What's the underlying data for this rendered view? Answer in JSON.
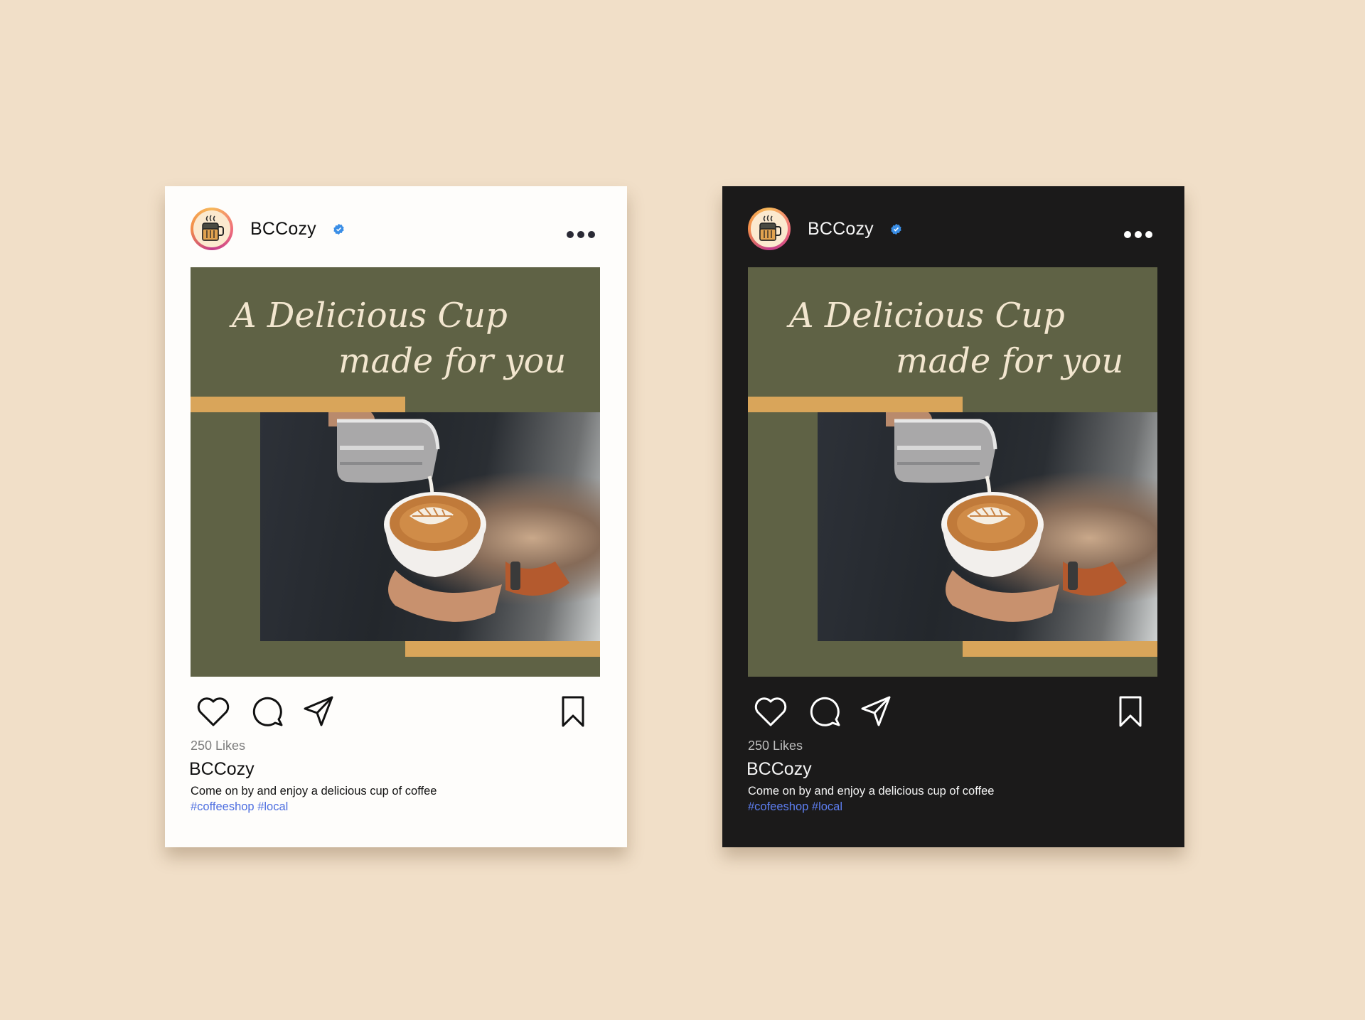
{
  "posts": [
    {
      "theme": "light",
      "username": "BCCozy",
      "verified_icon": "verified-badge-icon",
      "post_title_line1": "A Delicious Cup",
      "post_title_line2": "made for you",
      "likes": "250 Likes",
      "caption_user": "BCCozy",
      "caption": "Come on by and enjoy a delicious cup of coffee",
      "hashtags": "#coffeeshop #local"
    },
    {
      "theme": "dark",
      "username": "BCCozy",
      "verified_icon": "verified-badge-icon",
      "post_title_line1": "A Delicious Cup",
      "post_title_line2": "made for you",
      "likes": "250 Likes",
      "caption_user": "BCCozy",
      "caption": "Come on by and enjoy a delicious cup of coffee",
      "hashtags": "#cofeeshop #local"
    }
  ],
  "colors": {
    "background": "#f1dfc8",
    "post_green": "#5f6245",
    "accent_gold": "#d9a55a",
    "title_cream": "#f2e6cf",
    "hashtag_blue": "#4d6ee0",
    "verified_blue": "#3a8ee6"
  },
  "icons": [
    "coffee-mug-icon",
    "verified-badge-icon",
    "more-options-icon",
    "heart-icon",
    "comment-icon",
    "share-icon",
    "bookmark-icon"
  ]
}
